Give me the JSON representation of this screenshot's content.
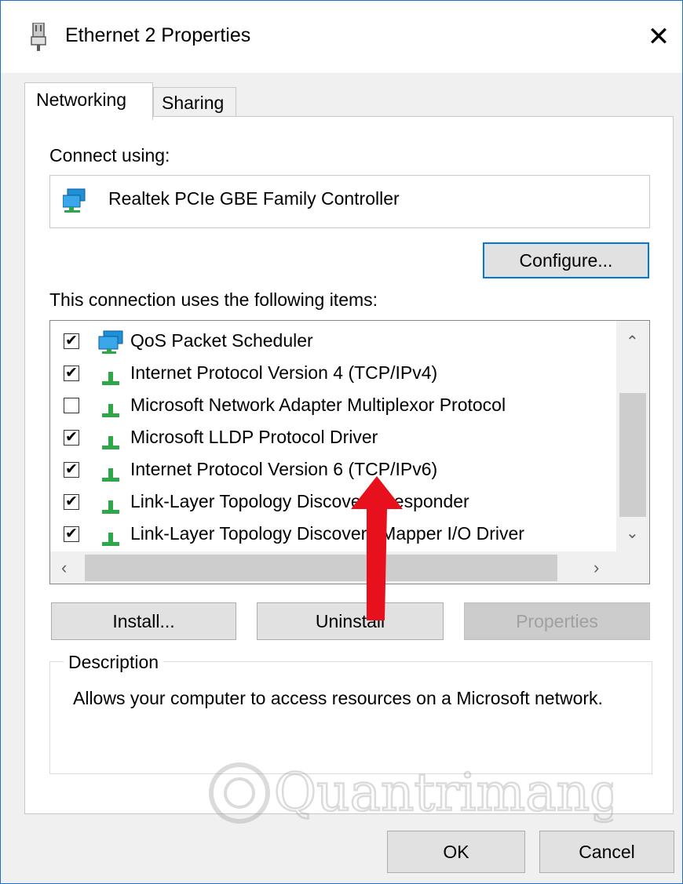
{
  "window": {
    "title": "Ethernet 2 Properties"
  },
  "tabs": [
    {
      "label": "Networking",
      "active": true
    },
    {
      "label": "Sharing",
      "active": false
    }
  ],
  "connect_using": {
    "label": "Connect using:",
    "adapter": "Realtek PCIe GBE Family Controller",
    "configure_button": "Configure..."
  },
  "items_section": {
    "label": "This connection uses the following items:",
    "items": [
      {
        "label": "QoS Packet Scheduler",
        "checked": true,
        "icon": "network-service-icon"
      },
      {
        "label": "Internet Protocol Version 4 (TCP/IPv4)",
        "checked": true,
        "icon": "protocol-icon"
      },
      {
        "label": "Microsoft Network Adapter Multiplexor Protocol",
        "checked": false,
        "icon": "protocol-icon"
      },
      {
        "label": "Microsoft LLDP Protocol Driver",
        "checked": true,
        "icon": "protocol-icon"
      },
      {
        "label": "Internet Protocol Version 6 (TCP/IPv6)",
        "checked": true,
        "icon": "protocol-icon"
      },
      {
        "label": "Link-Layer Topology Discovery Responder",
        "checked": true,
        "icon": "protocol-icon"
      },
      {
        "label": "Link-Layer Topology Discovery Mapper I/O Driver",
        "checked": true,
        "icon": "protocol-icon"
      }
    ]
  },
  "buttons": {
    "install": "Install...",
    "uninstall": "Uninstall",
    "properties": "Properties",
    "ok": "OK",
    "cancel": "Cancel"
  },
  "description": {
    "legend": "Description",
    "text": "Allows your computer to access resources on a Microsoft network."
  },
  "watermark": {
    "text": "Quantrimang"
  },
  "colors": {
    "accent": "#0078d7",
    "annotation_arrow": "#e8101c",
    "protocol_green": "#2fa64a"
  }
}
